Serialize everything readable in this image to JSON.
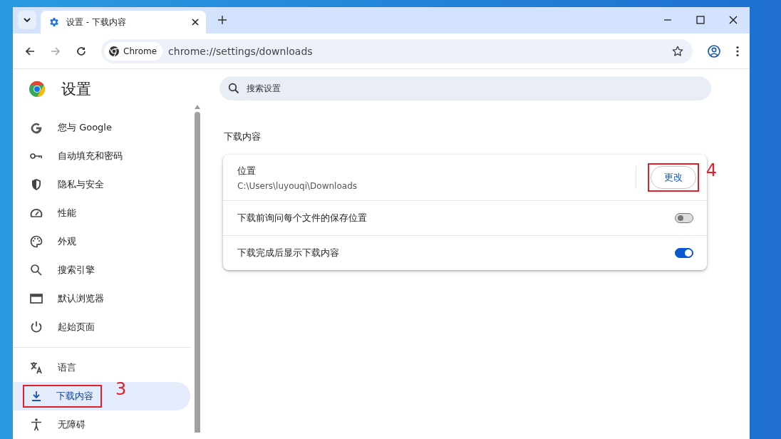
{
  "tab": {
    "title": "设置 - 下载内容"
  },
  "toolbar": {
    "chip": "Chrome",
    "url": "chrome://settings/downloads"
  },
  "sidebar": {
    "title": "设置",
    "groups": [
      {
        "items": [
          {
            "label": "您与 Google",
            "selected": false
          },
          {
            "label": "自动填充和密码",
            "selected": false
          },
          {
            "label": "隐私与安全",
            "selected": false
          },
          {
            "label": "性能",
            "selected": false
          },
          {
            "label": "外观",
            "selected": false
          },
          {
            "label": "搜索引擎",
            "selected": false
          },
          {
            "label": "默认浏览器",
            "selected": false
          },
          {
            "label": "起始页面",
            "selected": false
          }
        ]
      },
      {
        "items": [
          {
            "label": "语言",
            "selected": false
          },
          {
            "label": "下载内容",
            "selected": true,
            "annotation": "3"
          },
          {
            "label": "无障碍",
            "selected": false
          }
        ]
      }
    ]
  },
  "search": {
    "placeholder": "搜索设置"
  },
  "section": {
    "title": "下载内容",
    "rows": [
      {
        "kind": "location",
        "label": "位置",
        "value": "C:\\Users\\luyouqi\\Downloads",
        "button": "更改",
        "annotation": "4"
      },
      {
        "kind": "toggle",
        "label": "下载前询问每个文件的保存位置",
        "on": false
      },
      {
        "kind": "toggle",
        "label": "下载完成后显示下载内容",
        "on": true
      }
    ]
  }
}
